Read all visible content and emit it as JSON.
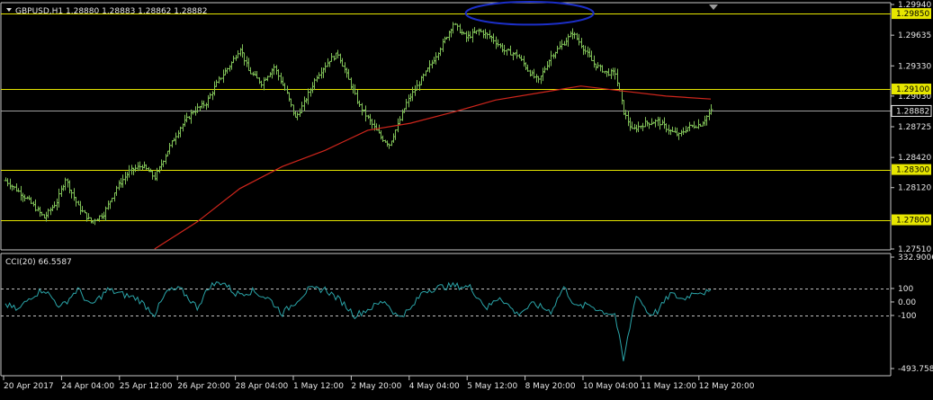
{
  "chart_data": [
    {
      "type": "bar",
      "style": "ohlc",
      "title": "GBPUSD,H1 1.28880 1.28883 1.28862 1.28882",
      "symbol": "GBPUSD",
      "timeframe": "H1",
      "ohlc_header": [
        "1.28880",
        "1.28883",
        "1.28862",
        "1.28882"
      ],
      "ylim": [
        1.2751,
        1.2994
      ],
      "yticks": [
        "1.29940",
        "1.29635",
        "1.29330",
        "1.29030",
        "1.28725",
        "1.28420",
        "1.28120",
        "1.27510"
      ],
      "xticks": [
        "20 Apr 2017",
        "24 Apr 04:00",
        "25 Apr 12:00",
        "26 Apr 20:00",
        "28 Apr 04:00",
        "1 May 12:00",
        "2 May 20:00",
        "4 May 04:00",
        "5 May 12:00",
        "8 May 20:00",
        "10 May 04:00",
        "11 May 12:00",
        "12 May 20:00"
      ],
      "horizontal_levels": [
        {
          "price": 1.2985,
          "label": "1.29850"
        },
        {
          "price": 1.291,
          "label": "1.29100"
        },
        {
          "price": 1.283,
          "label": "1.28300"
        },
        {
          "price": 1.278,
          "label": "1.27800"
        }
      ],
      "current_price": {
        "price": 1.28882,
        "label": "1.28882"
      },
      "close_path": [
        [
          0,
          1.2819
        ],
        [
          10,
          1.2801
        ],
        [
          18,
          1.2782
        ],
        [
          24,
          1.2798
        ],
        [
          28,
          1.2821
        ],
        [
          34,
          1.2793
        ],
        [
          40,
          1.2778
        ],
        [
          46,
          1.2786
        ],
        [
          52,
          1.2812
        ],
        [
          58,
          1.2828
        ],
        [
          64,
          1.2834
        ],
        [
          70,
          1.2822
        ],
        [
          76,
          1.2849
        ],
        [
          82,
          1.2872
        ],
        [
          88,
          1.2888
        ],
        [
          94,
          1.2896
        ],
        [
          100,
          1.2919
        ],
        [
          106,
          1.2936
        ],
        [
          110,
          1.2951
        ],
        [
          114,
          1.2928
        ],
        [
          120,
          1.2916
        ],
        [
          126,
          1.2932
        ],
        [
          132,
          1.2905
        ],
        [
          136,
          1.2881
        ],
        [
          140,
          1.2896
        ],
        [
          146,
          1.2923
        ],
        [
          152,
          1.2939
        ],
        [
          156,
          1.2945
        ],
        [
          160,
          1.2924
        ],
        [
          166,
          1.2893
        ],
        [
          170,
          1.2881
        ],
        [
          176,
          1.2862
        ],
        [
          180,
          1.2855
        ],
        [
          184,
          1.2874
        ],
        [
          188,
          1.2896
        ],
        [
          194,
          1.2916
        ],
        [
          200,
          1.2936
        ],
        [
          206,
          1.2959
        ],
        [
          210,
          1.2975
        ],
        [
          216,
          1.2961
        ],
        [
          222,
          1.2968
        ],
        [
          228,
          1.2961
        ],
        [
          234,
          1.2948
        ],
        [
          240,
          1.2944
        ],
        [
          246,
          1.2926
        ],
        [
          250,
          1.2918
        ],
        [
          256,
          1.2943
        ],
        [
          262,
          1.2956
        ],
        [
          266,
          1.2966
        ],
        [
          270,
          1.2954
        ],
        [
          276,
          1.2935
        ],
        [
          282,
          1.2926
        ],
        [
          286,
          1.2926
        ],
        [
          290,
          1.2887
        ],
        [
          294,
          1.2869
        ],
        [
          300,
          1.2876
        ],
        [
          306,
          1.2878
        ],
        [
          312,
          1.2868
        ],
        [
          316,
          1.2864
        ],
        [
          320,
          1.2872
        ],
        [
          326,
          1.2875
        ],
        [
          331,
          1.2888
        ]
      ],
      "series": [
        {
          "name": "price",
          "color": "#7fbf57"
        },
        {
          "name": "moving_average",
          "color": "#d0261c",
          "points": [
            [
              70,
              1.2751
            ],
            [
              90,
              1.2778
            ],
            [
              110,
              1.2811
            ],
            [
              130,
              1.2833
            ],
            [
              150,
              1.2849
            ],
            [
              170,
              1.2869
            ],
            [
              190,
              1.2876
            ],
            [
              210,
              1.2887
            ],
            [
              230,
              1.2899
            ],
            [
              250,
              1.2906
            ],
            [
              270,
              1.2913
            ],
            [
              290,
              1.2908
            ],
            [
              310,
              1.2903
            ],
            [
              331,
              1.29
            ]
          ]
        }
      ],
      "annotation": {
        "shape": "ellipse",
        "color": "#1c2fc8",
        "x": [
          216,
          276
        ],
        "y": [
          1.2982,
          1.2994
        ]
      }
    },
    {
      "type": "line",
      "title": "CCI(20) 66.5587",
      "indicator": "CCI",
      "period": 20,
      "current_value": 66.5587,
      "ylim": [
        -493.7586,
        332.9006
      ],
      "yticks": [
        "332.9006",
        "100",
        "0.00",
        "-100",
        "-493.7586"
      ],
      "reference_levels": [
        100,
        -100
      ],
      "color": "#2aa4a8",
      "key_points": [
        [
          0,
          -20
        ],
        [
          6,
          -60
        ],
        [
          12,
          40
        ],
        [
          18,
          95
        ],
        [
          26,
          -40
        ],
        [
          34,
          95
        ],
        [
          40,
          -30
        ],
        [
          48,
          90
        ],
        [
          54,
          60
        ],
        [
          62,
          25
        ],
        [
          70,
          -90
        ],
        [
          76,
          80
        ],
        [
          82,
          95
        ],
        [
          90,
          -40
        ],
        [
          96,
          120
        ],
        [
          102,
          150
        ],
        [
          108,
          60
        ],
        [
          116,
          80
        ],
        [
          124,
          20
        ],
        [
          130,
          -85
        ],
        [
          136,
          0
        ],
        [
          142,
          90
        ],
        [
          150,
          95
        ],
        [
          158,
          0
        ],
        [
          164,
          -100
        ],
        [
          170,
          -55
        ],
        [
          178,
          10
        ],
        [
          184,
          -110
        ],
        [
          190,
          -60
        ],
        [
          196,
          80
        ],
        [
          204,
          110
        ],
        [
          210,
          120
        ],
        [
          218,
          110
        ],
        [
          226,
          -45
        ],
        [
          232,
          40
        ],
        [
          240,
          -90
        ],
        [
          248,
          -15
        ],
        [
          256,
          -70
        ],
        [
          262,
          110
        ],
        [
          268,
          -40
        ],
        [
          274,
          -20
        ],
        [
          280,
          -70
        ],
        [
          286,
          -90
        ],
        [
          290,
          -440
        ],
        [
          296,
          60
        ],
        [
          302,
          -90
        ],
        [
          306,
          -70
        ],
        [
          312,
          60
        ],
        [
          318,
          20
        ],
        [
          324,
          80
        ],
        [
          331,
          66.5587
        ]
      ]
    }
  ]
}
